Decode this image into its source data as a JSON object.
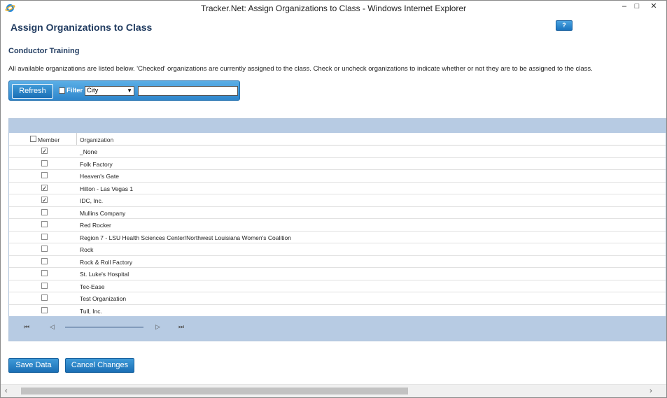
{
  "window": {
    "title": "Tracker.Net: Assign Organizations to Class - Windows Internet Explorer",
    "icon": "ie-icon",
    "minimize_glyph": "–",
    "maximize_glyph": "□",
    "close_glyph": "✕"
  },
  "page": {
    "title": "Assign Organizations to Class",
    "help_label": "?",
    "subtitle": "Conductor Training",
    "description": "All available organizations are listed below. 'Checked' organizations are currently assigned to the class. Check or uncheck organizations to indicate whether or not they are to be assigned to the class."
  },
  "toolbar": {
    "refresh_label": "Refresh",
    "filter_label": "Filter",
    "filter_checked": false,
    "filter_field": "City",
    "filter_value": ""
  },
  "grid": {
    "columns": {
      "member": "Member",
      "organization": "Organization"
    },
    "rows": [
      {
        "checked": true,
        "organization": "_None"
      },
      {
        "checked": false,
        "organization": "Folk Factory"
      },
      {
        "checked": false,
        "organization": "Heaven's Gate"
      },
      {
        "checked": true,
        "organization": "Hilton - Las Vegas 1"
      },
      {
        "checked": true,
        "organization": "IDC, Inc."
      },
      {
        "checked": false,
        "organization": "Mullins Company"
      },
      {
        "checked": false,
        "organization": "Red Rocker"
      },
      {
        "checked": false,
        "organization": "Region 7 - LSU Health Sciences Center/Northwest Louisiana Women's Coalition"
      },
      {
        "checked": false,
        "organization": "Rock"
      },
      {
        "checked": false,
        "organization": "Rock & Roll Factory"
      },
      {
        "checked": false,
        "organization": "St. Luke's Hospital"
      },
      {
        "checked": false,
        "organization": "Tec-Ease"
      },
      {
        "checked": false,
        "organization": "Test Organization"
      },
      {
        "checked": false,
        "organization": "Tull, Inc."
      }
    ],
    "check_glyph": "✓"
  },
  "pager": {
    "first_glyph": "⏮",
    "prev_glyph": "◁",
    "next_glyph": "▷",
    "last_glyph": "⏭"
  },
  "actions": {
    "save_label": "Save Data",
    "cancel_label": "Cancel Changes"
  },
  "scrollbar": {
    "left_glyph": "‹",
    "right_glyph": "›"
  }
}
